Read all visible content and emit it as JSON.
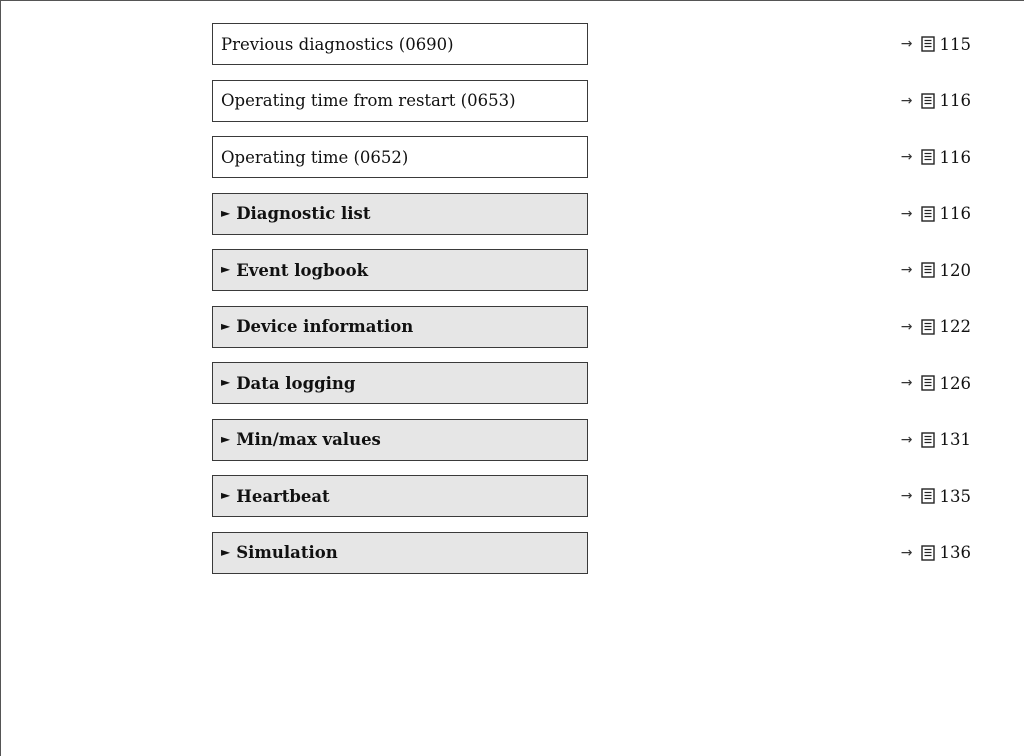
{
  "rows": [
    {
      "label": "Previous diagnostics (0690)",
      "type": "parameter",
      "page": "115"
    },
    {
      "label": "Operating time from restart (0653)",
      "type": "parameter",
      "page": "116"
    },
    {
      "label": "Operating time (0652)",
      "type": "parameter",
      "page": "116"
    },
    {
      "label": "Diagnostic list",
      "type": "submenu",
      "page": "116"
    },
    {
      "label": "Event logbook",
      "type": "submenu",
      "page": "120"
    },
    {
      "label": "Device information",
      "type": "submenu",
      "page": "122"
    },
    {
      "label": "Data logging",
      "type": "submenu",
      "page": "126"
    },
    {
      "label": "Min/max values",
      "type": "submenu",
      "page": "131"
    },
    {
      "label": "Heartbeat",
      "type": "submenu",
      "page": "135"
    },
    {
      "label": "Simulation",
      "type": "submenu",
      "page": "136"
    }
  ],
  "ref_arrow": "→",
  "submenu_marker": "►",
  "icons": {
    "reference": "book-icon"
  }
}
